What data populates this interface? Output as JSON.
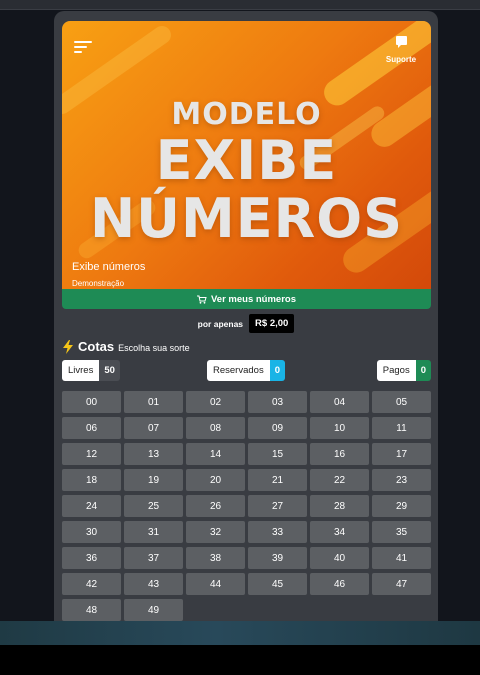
{
  "banner": {
    "hero_line1": "MODELO",
    "hero_line2": "EXIBE",
    "hero_line3": "NÚMEROS",
    "title": "Exibe números",
    "subtitle": "Demonstração",
    "support_label": "Suporte",
    "menu_icon": "menu-icon",
    "support_icon": "chat-icon"
  },
  "cta": {
    "label": "Ver meus números",
    "icon": "cart-icon"
  },
  "price": {
    "label": "por apenas",
    "value": "R$ 2,00"
  },
  "cotas": {
    "title": "Cotas",
    "subtitle": "Escolha sua sorte",
    "icon": "bolt-icon"
  },
  "status": {
    "livres": {
      "label": "Livres",
      "count": "50"
    },
    "reservados": {
      "label": "Reservados",
      "count": "0"
    },
    "pagos": {
      "label": "Pagos",
      "count": "0"
    }
  },
  "numbers": [
    "00",
    "01",
    "02",
    "03",
    "04",
    "05",
    "06",
    "07",
    "08",
    "09",
    "10",
    "11",
    "12",
    "13",
    "14",
    "15",
    "16",
    "17",
    "18",
    "19",
    "20",
    "21",
    "22",
    "23",
    "24",
    "25",
    "26",
    "27",
    "28",
    "29",
    "30",
    "31",
    "32",
    "33",
    "34",
    "35",
    "36",
    "37",
    "38",
    "39",
    "40",
    "41",
    "42",
    "43",
    "44",
    "45",
    "46",
    "47",
    "48",
    "49"
  ],
  "colors": {
    "accent_green": "#1e8b55",
    "reserved_blue": "#19b4e6",
    "tile_gray": "#5c5f63"
  }
}
